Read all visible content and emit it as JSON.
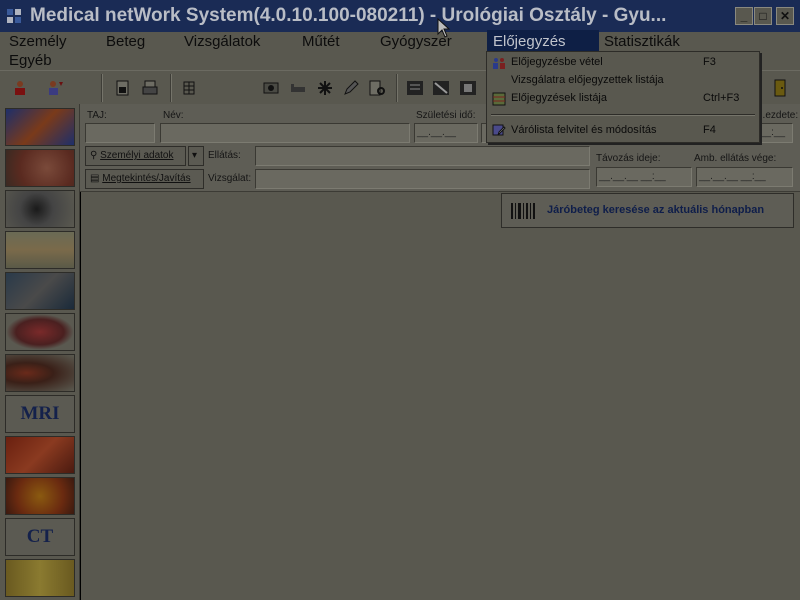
{
  "window": {
    "title": "Medical netWork System(4.0.10.100-080211) - Urológiai Osztály - Gyu...",
    "minimize": "_",
    "maximize": "□",
    "close": "✕"
  },
  "menubar": {
    "items": [
      "Személy",
      "Beteg",
      "Vizsgálatok",
      "Műtét",
      "Gyógyszer",
      "Előjegyzés",
      "Statisztikák",
      "Egyéb"
    ],
    "active": "Előjegyzés"
  },
  "dropdown": {
    "items": [
      {
        "label": "Előjegyzésbe vétel",
        "shortcut": "F3",
        "icon": "people-add-icon"
      },
      {
        "label": "Vizsgálatra előjegyzettek listája",
        "shortcut": "",
        "icon": ""
      },
      {
        "label": "Előjegyzések listája",
        "shortcut": "Ctrl+F3",
        "icon": "grid-list-icon"
      },
      {
        "label": "Várólista felvitel és módosítás",
        "shortcut": "F4",
        "icon": "edit-list-icon"
      }
    ]
  },
  "form": {
    "taj_label": "TAJ:",
    "nev_label": "Név:",
    "szuletesi_label": "Születési idő:",
    "kezdete_label": "...ezdete:",
    "szemelyi_button": "Személyi adatok",
    "megtekintes_button": "Megtekintés/Javítás",
    "ellatas_label": "Ellátás:",
    "vizsgalat_label": "Vizsgálat:",
    "tavozas_label": "Távozás ideje:",
    "amb_label": "Amb. ellátás vége:",
    "date_placeholder": "__.__.__",
    "datetime_placeholder": "__.__.__ __:__",
    "time_placeholder": "__:__"
  },
  "search_button": {
    "label": "Járóbeteg keresése az aktuális hónapban"
  },
  "left_strip": {
    "items": [
      "hand",
      "ear",
      "heart",
      "body",
      "imaging",
      "lungs",
      "kidneys",
      "MRI",
      "vessels",
      "intestine",
      "CT",
      "joint"
    ]
  },
  "colors": {
    "titlebar": "#1a2b55",
    "panel": "#59584f",
    "menu_highlight": "#0e1f45",
    "link_blue": "#0f1e4a"
  }
}
